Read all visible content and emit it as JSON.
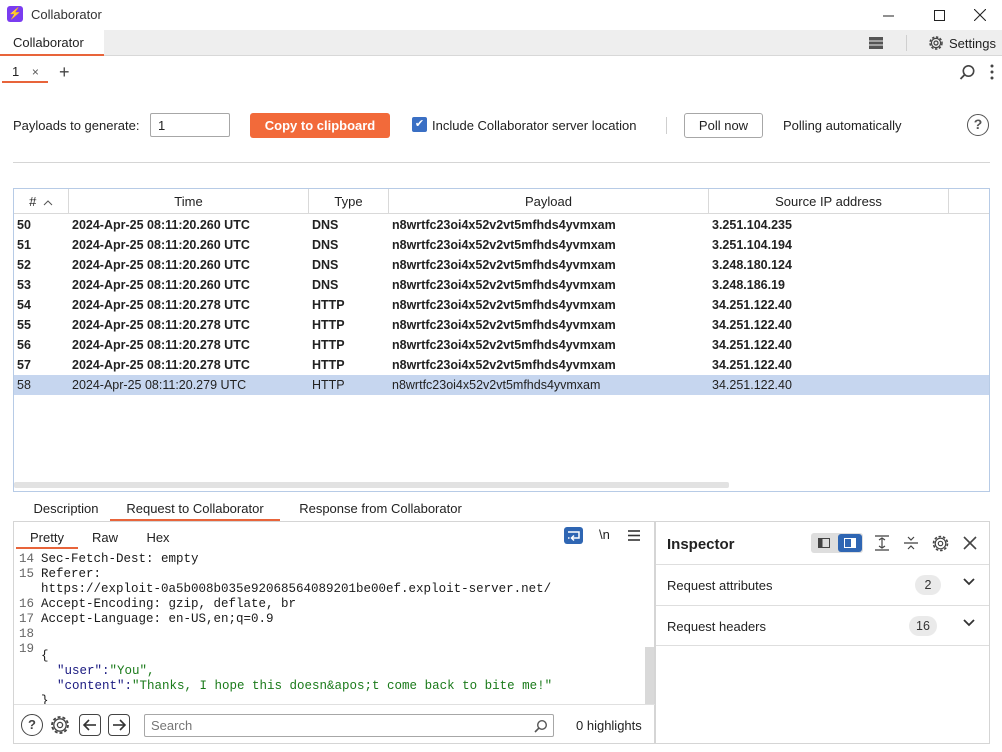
{
  "window": {
    "title": "Collaborator",
    "logo_glyph": "⚡"
  },
  "top_tab": {
    "label": "Collaborator"
  },
  "settings": {
    "label": "Settings"
  },
  "subtab": {
    "label": "1",
    "close": "×",
    "add": "+"
  },
  "toolbar": {
    "payloads_label": "Payloads to generate:",
    "payloads_value": "1",
    "copy_label": "Copy to clipboard",
    "include_label": "Include Collaborator server location",
    "include_checked": true,
    "poll_label": "Poll now",
    "polling_label": "Polling automatically",
    "help": "?"
  },
  "table": {
    "headers": {
      "num": "#",
      "time": "Time",
      "type": "Type",
      "payload": "Payload",
      "source_ip": "Source IP address"
    },
    "rows": [
      {
        "num": "50",
        "time": "2024-Apr-25 08:11:20.260 UTC",
        "type": "DNS",
        "payload": "n8wrtfc23oi4x52v2vt5mfhds4yvmxam",
        "ip": "3.251.104.235"
      },
      {
        "num": "51",
        "time": "2024-Apr-25 08:11:20.260 UTC",
        "type": "DNS",
        "payload": "n8wrtfc23oi4x52v2vt5mfhds4yvmxam",
        "ip": "3.251.104.194"
      },
      {
        "num": "52",
        "time": "2024-Apr-25 08:11:20.260 UTC",
        "type": "DNS",
        "payload": "n8wrtfc23oi4x52v2vt5mfhds4yvmxam",
        "ip": "3.248.180.124"
      },
      {
        "num": "53",
        "time": "2024-Apr-25 08:11:20.260 UTC",
        "type": "DNS",
        "payload": "n8wrtfc23oi4x52v2vt5mfhds4yvmxam",
        "ip": "3.248.186.19"
      },
      {
        "num": "54",
        "time": "2024-Apr-25 08:11:20.278 UTC",
        "type": "HTTP",
        "payload": "n8wrtfc23oi4x52v2vt5mfhds4yvmxam",
        "ip": "34.251.122.40"
      },
      {
        "num": "55",
        "time": "2024-Apr-25 08:11:20.278 UTC",
        "type": "HTTP",
        "payload": "n8wrtfc23oi4x52v2vt5mfhds4yvmxam",
        "ip": "34.251.122.40"
      },
      {
        "num": "56",
        "time": "2024-Apr-25 08:11:20.278 UTC",
        "type": "HTTP",
        "payload": "n8wrtfc23oi4x52v2vt5mfhds4yvmxam",
        "ip": "34.251.122.40"
      },
      {
        "num": "57",
        "time": "2024-Apr-25 08:11:20.278 UTC",
        "type": "HTTP",
        "payload": "n8wrtfc23oi4x52v2vt5mfhds4yvmxam",
        "ip": "34.251.122.40"
      },
      {
        "num": "58",
        "time": "2024-Apr-25 08:11:20.279 UTC",
        "type": "HTTP",
        "payload": "n8wrtfc23oi4x52v2vt5mfhds4yvmxam",
        "ip": "34.251.122.40"
      }
    ]
  },
  "lower_tabs": {
    "description": "Description",
    "request": "Request to Collaborator",
    "response": "Response from Collaborator"
  },
  "request_view": {
    "tabs": {
      "pretty": "Pretty",
      "raw": "Raw",
      "hex": "Hex"
    },
    "newline_label": "\\n",
    "lines": {
      "l14": {
        "n": "14",
        "text": "Sec-Fetch-Dest: empty"
      },
      "l15": {
        "n": "15",
        "text": "Referer:"
      },
      "l15b": {
        "text": "https://exploit-0a5b008b035e92068564089201be00ef.exploit-server.net/"
      },
      "l16": {
        "n": "16",
        "text": "Accept-Encoding: gzip, deflate, br"
      },
      "l17": {
        "n": "17",
        "text": "Accept-Language: en-US,en;q=0.9"
      },
      "l18": {
        "n": "18"
      },
      "l19": {
        "n": "19",
        "text": "{"
      },
      "user_key": "\"user\":",
      "user_val": "\"You\",",
      "content_key": "\"content\":",
      "content_val": "\"Thanks, I hope this doesn&apos;t come back to bite me!\"",
      "close": "}"
    },
    "search_placeholder": "Search",
    "highlights": "0 highlights"
  },
  "inspector": {
    "title": "Inspector",
    "request_attributes": {
      "label": "Request attributes",
      "count": "2"
    },
    "request_headers": {
      "label": "Request headers",
      "count": "16"
    }
  },
  "colors": {
    "accent": "#e8643a",
    "selection": "#c6d6ef",
    "check": "#3a6fc4"
  }
}
